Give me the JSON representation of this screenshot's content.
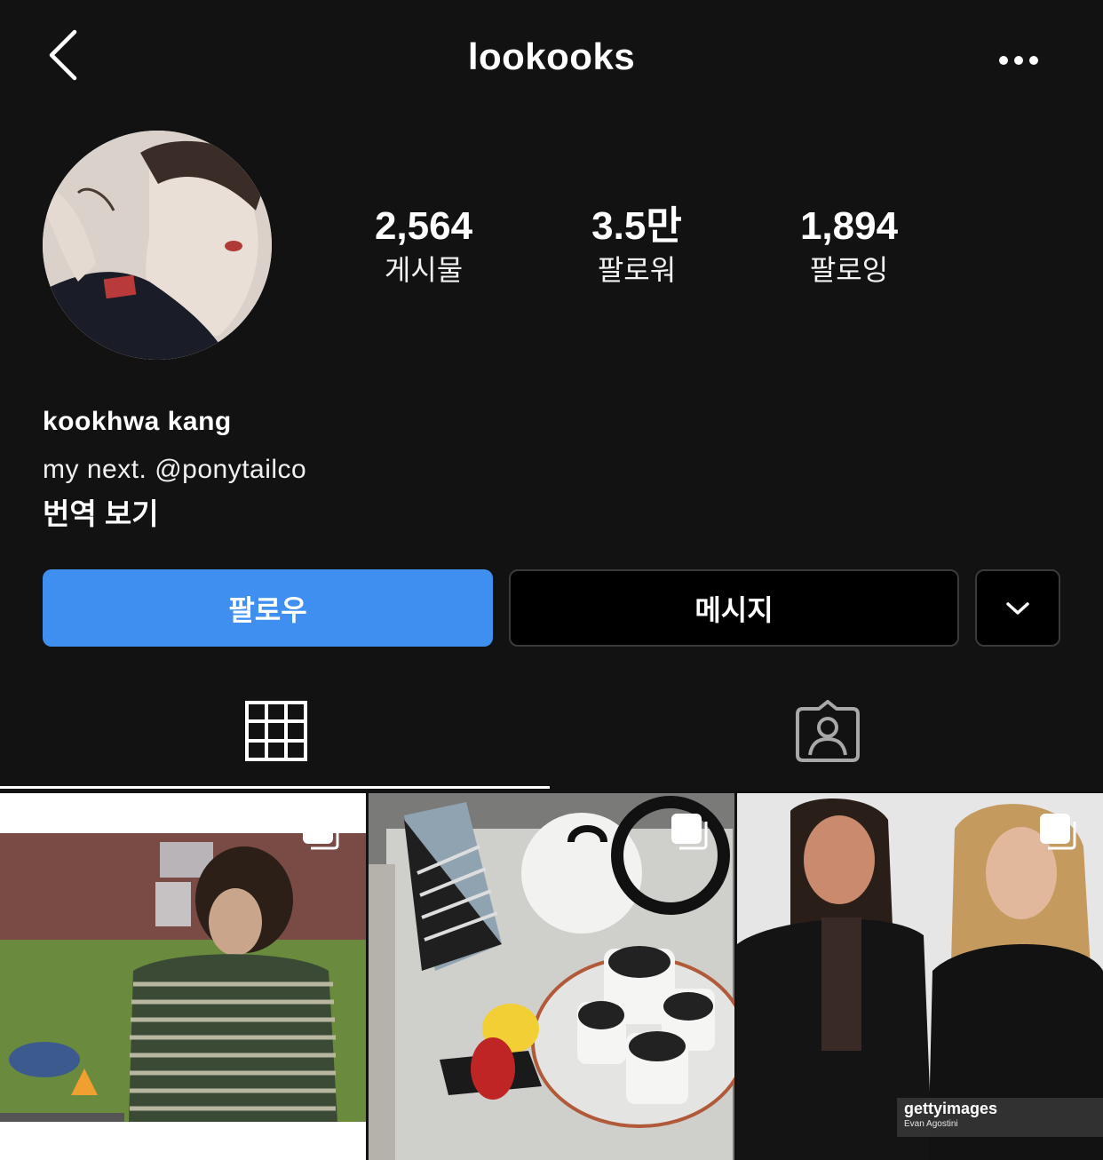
{
  "header": {
    "back_icon": "chevron-left-icon",
    "username": "lookooks",
    "more_icon": "more-horizontal-icon"
  },
  "profile": {
    "stats": [
      {
        "value": "2,564",
        "label": "게시물"
      },
      {
        "value": "3.5만",
        "label": "팔로워"
      },
      {
        "value": "1,894",
        "label": "팔로잉"
      }
    ],
    "display_name": "kookhwa kang",
    "bio": "my next. @ponytailco",
    "translate_label": "번역 보기"
  },
  "actions": {
    "follow_label": "팔로우",
    "message_label": "메시지",
    "dropdown_icon": "chevron-down-icon"
  },
  "tabs": [
    {
      "icon": "grid-icon",
      "active": true
    },
    {
      "icon": "tagged-user-icon",
      "active": false
    }
  ],
  "posts": [
    {
      "type": "carousel"
    },
    {
      "type": "carousel"
    },
    {
      "type": "carousel",
      "watermark": "gettyimages",
      "credit": "Evan Agostini"
    }
  ],
  "colors": {
    "background": "#121212",
    "follow_button": "#3f8ff0",
    "text": "#ffffff"
  }
}
